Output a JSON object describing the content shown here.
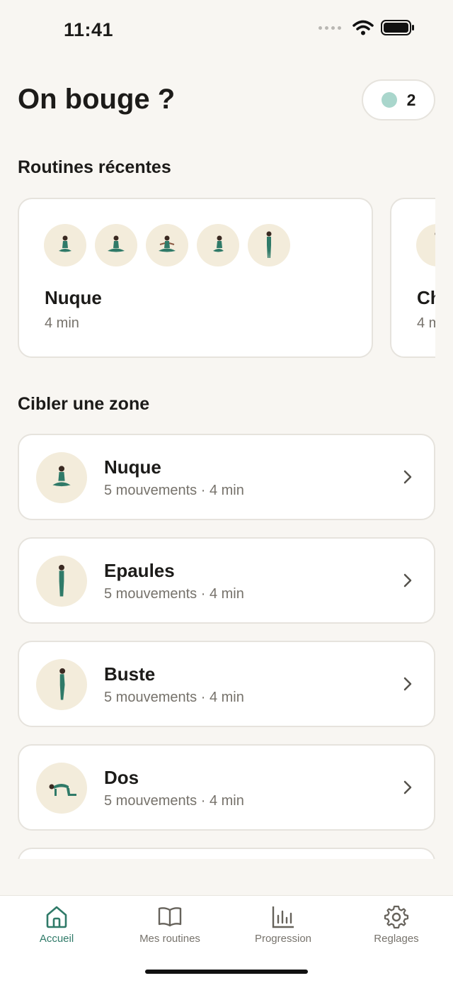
{
  "status_bar": {
    "time": "11:41"
  },
  "header": {
    "title": "On bouge ?",
    "coins": "2"
  },
  "recent": {
    "section_title": "Routines récentes",
    "cards": [
      {
        "name": "Nuque",
        "duration": "4 min"
      },
      {
        "name": "Ch",
        "duration": "4 m"
      }
    ]
  },
  "zones": {
    "section_title": "Cibler une zone",
    "items": [
      {
        "name": "Nuque",
        "meta": "5 mouvements · 4 min",
        "icon": "seated-pose-icon"
      },
      {
        "name": "Epaules",
        "meta": "5 mouvements · 4 min",
        "icon": "standing-pose-icon"
      },
      {
        "name": "Buste",
        "meta": "5 mouvements · 4 min",
        "icon": "side-standing-pose-icon"
      },
      {
        "name": "Dos",
        "meta": "5 mouvements · 4 min",
        "icon": "tabletop-pose-icon"
      }
    ]
  },
  "tab_bar": {
    "tabs": [
      {
        "label": "Accueil",
        "icon": "home-icon",
        "active": true
      },
      {
        "label": "Mes routines",
        "icon": "book-icon",
        "active": false
      },
      {
        "label": "Progression",
        "icon": "bar-chart-icon",
        "active": false
      },
      {
        "label": "Reglages",
        "icon": "gear-icon",
        "active": false
      }
    ]
  },
  "colors": {
    "accent": "#2f7a68",
    "figure": "#2f7a68",
    "thumb_bg": "#f3ecdb",
    "coin": "#a9d6cc"
  }
}
